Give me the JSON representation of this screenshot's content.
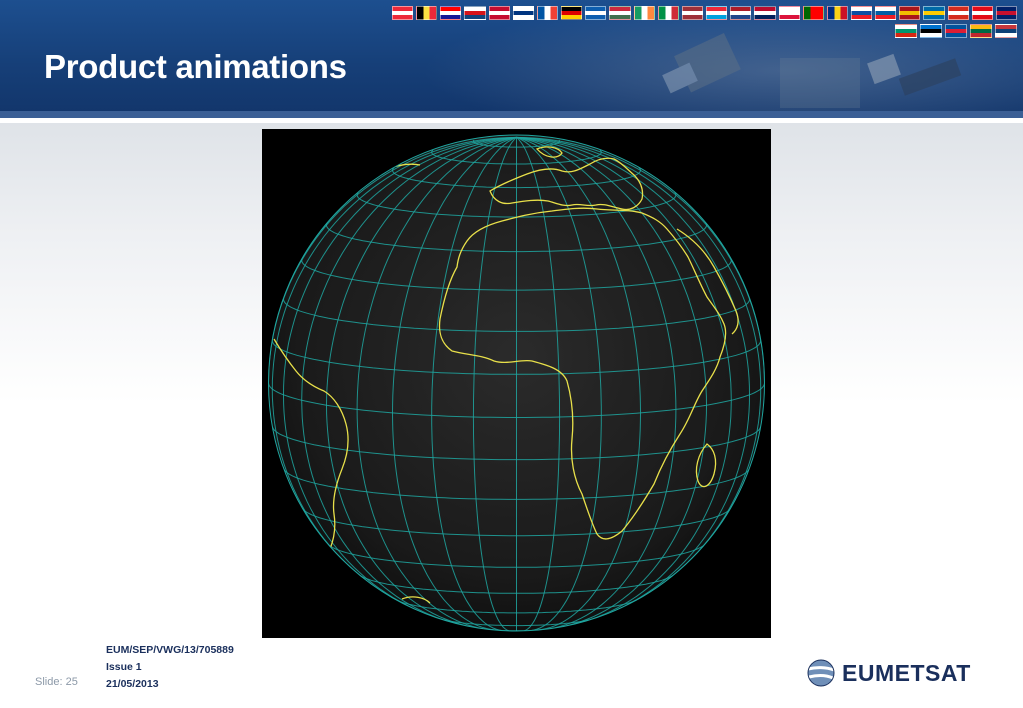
{
  "slide": {
    "title": "Product animations",
    "slide_label": "Slide: 25",
    "doc_ref": "EUM/SEP/VWG/13/705889",
    "issue": "Issue 1",
    "date": "21/05/2013"
  },
  "logo": {
    "text": "EUMETSAT",
    "icon": "eumetsat-globe-icon"
  },
  "flags": {
    "row1": [
      {
        "name": "austria",
        "c": [
          "#ed2939",
          "#ffffff",
          "#ed2939"
        ],
        "dir": "h"
      },
      {
        "name": "belgium",
        "c": [
          "#000000",
          "#fae042",
          "#ed2939"
        ],
        "dir": "v"
      },
      {
        "name": "croatia",
        "c": [
          "#ff0000",
          "#ffffff",
          "#171796"
        ],
        "dir": "h"
      },
      {
        "name": "czech",
        "c": [
          "#ffffff",
          "#d7141a",
          "#11457e"
        ],
        "dir": "h"
      },
      {
        "name": "denmark",
        "c": [
          "#c60c30",
          "#ffffff",
          "#c60c30"
        ],
        "dir": "h"
      },
      {
        "name": "finland",
        "c": [
          "#ffffff",
          "#003580",
          "#ffffff"
        ],
        "dir": "h"
      },
      {
        "name": "france",
        "c": [
          "#0055a4",
          "#ffffff",
          "#ef4135"
        ],
        "dir": "v"
      },
      {
        "name": "germany",
        "c": [
          "#000000",
          "#dd0000",
          "#ffce00"
        ],
        "dir": "h"
      },
      {
        "name": "greece",
        "c": [
          "#0d5eaf",
          "#ffffff",
          "#0d5eaf"
        ],
        "dir": "h"
      },
      {
        "name": "hungary",
        "c": [
          "#cd2a3e",
          "#ffffff",
          "#436f4d"
        ],
        "dir": "h"
      },
      {
        "name": "ireland",
        "c": [
          "#169b62",
          "#ffffff",
          "#ff883e"
        ],
        "dir": "v"
      },
      {
        "name": "italy",
        "c": [
          "#009246",
          "#ffffff",
          "#ce2b37"
        ],
        "dir": "v"
      },
      {
        "name": "latvia",
        "c": [
          "#9e3039",
          "#ffffff",
          "#9e3039"
        ],
        "dir": "h"
      },
      {
        "name": "luxembourg",
        "c": [
          "#ed2939",
          "#ffffff",
          "#00a1de"
        ],
        "dir": "h"
      },
      {
        "name": "netherlands",
        "c": [
          "#ae1c28",
          "#ffffff",
          "#21468b"
        ],
        "dir": "h"
      },
      {
        "name": "norway",
        "c": [
          "#ba0c2f",
          "#ffffff",
          "#00205b"
        ],
        "dir": "h"
      },
      {
        "name": "poland",
        "c": [
          "#ffffff",
          "#ffffff",
          "#dc143c"
        ],
        "dir": "h"
      },
      {
        "name": "portugal",
        "c": [
          "#006600",
          "#ff0000",
          "#ff0000"
        ],
        "dir": "v"
      },
      {
        "name": "romania",
        "c": [
          "#002b7f",
          "#fcd116",
          "#ce1126"
        ],
        "dir": "v"
      },
      {
        "name": "slovakia",
        "c": [
          "#ffffff",
          "#0b4ea2",
          "#ee1c25"
        ],
        "dir": "h"
      },
      {
        "name": "slovenia",
        "c": [
          "#ffffff",
          "#005da4",
          "#ed1c24"
        ],
        "dir": "h"
      },
      {
        "name": "spain",
        "c": [
          "#aa151b",
          "#f1bf00",
          "#aa151b"
        ],
        "dir": "h"
      },
      {
        "name": "sweden",
        "c": [
          "#006aa7",
          "#fecc00",
          "#006aa7"
        ],
        "dir": "h"
      },
      {
        "name": "switzerland",
        "c": [
          "#d52b1e",
          "#ffffff",
          "#d52b1e"
        ],
        "dir": "h"
      },
      {
        "name": "turkey",
        "c": [
          "#e30a17",
          "#ffffff",
          "#e30a17"
        ],
        "dir": "h"
      },
      {
        "name": "uk",
        "c": [
          "#012169",
          "#c8102e",
          "#012169"
        ],
        "dir": "h"
      }
    ],
    "row2": [
      {
        "name": "bulgaria",
        "c": [
          "#ffffff",
          "#00966e",
          "#d62612"
        ],
        "dir": "h"
      },
      {
        "name": "estonia",
        "c": [
          "#0072ce",
          "#000000",
          "#ffffff"
        ],
        "dir": "h"
      },
      {
        "name": "iceland",
        "c": [
          "#02529c",
          "#dc1e35",
          "#02529c"
        ],
        "dir": "h"
      },
      {
        "name": "lithuania",
        "c": [
          "#fdb913",
          "#006a44",
          "#c1272d"
        ],
        "dir": "h"
      },
      {
        "name": "serbia",
        "c": [
          "#c6363c",
          "#0c4076",
          "#ffffff"
        ],
        "dir": "h"
      }
    ]
  },
  "colors": {
    "header": "#163f78",
    "title_text": "#ffffff",
    "coastline": "#e8e04a",
    "graticule": "#1fa6a0",
    "globe_bg": "#000000",
    "footer_text": "#1a2f5c"
  }
}
